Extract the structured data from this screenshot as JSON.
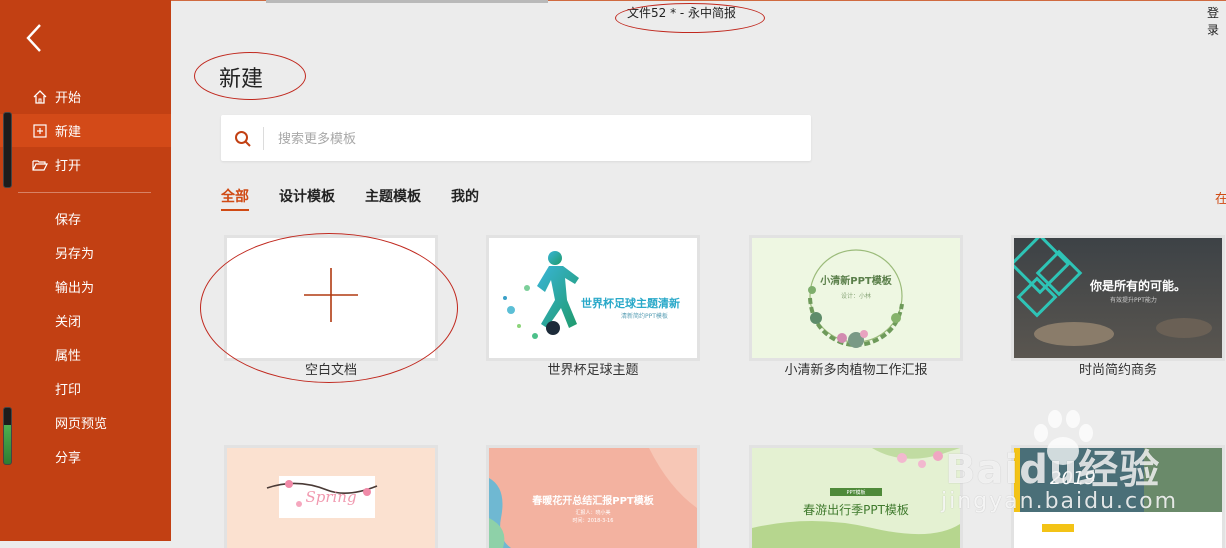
{
  "window": {
    "title": "文件52 * - 永中简报",
    "login": "登录"
  },
  "sidebar": {
    "items": [
      {
        "label": "开始",
        "icon": "home-icon"
      },
      {
        "label": "新建",
        "icon": "new-file-icon"
      },
      {
        "label": "打开",
        "icon": "folder-open-icon"
      }
    ],
    "sub_items": [
      "保存",
      "另存为",
      "输出为",
      "关闭",
      "属性",
      "打印",
      "网页预览",
      "分享"
    ]
  },
  "main": {
    "heading": "新建",
    "search": {
      "placeholder": "搜索更多模板"
    },
    "tabs": [
      "全部",
      "设计模板",
      "主题模板",
      "我的"
    ],
    "tab_right": "在",
    "templates": [
      {
        "label": "空白文档"
      },
      {
        "label": "世界杯足球主题",
        "thumb_title": "世界杯足球主题清新",
        "thumb_sub": "清新简约PPT模板"
      },
      {
        "label": "小清新多肉植物工作汇报",
        "thumb_title": "小清新PPT模板",
        "thumb_sub": "设计：小林"
      },
      {
        "label": "时尚简约商务",
        "thumb_title": "你是所有的可能。",
        "thumb_sub": "有效提升PPT能力"
      }
    ],
    "templates_row2": [
      {
        "thumb_title": "Spring"
      },
      {
        "thumb_title": "春暖花开总结汇报PPT模板",
        "thumb_sub": "汇报人：晓小美",
        "thumb_date": "时间：2018-3-16"
      },
      {
        "thumb_title": "春游出行季PPT模板",
        "thumb_badge": "PPT模板"
      },
      {
        "thumb_title": "2019"
      }
    ],
    "watermark": {
      "brand": "Baidu经验",
      "url": "jingyan.baidu.com"
    }
  }
}
